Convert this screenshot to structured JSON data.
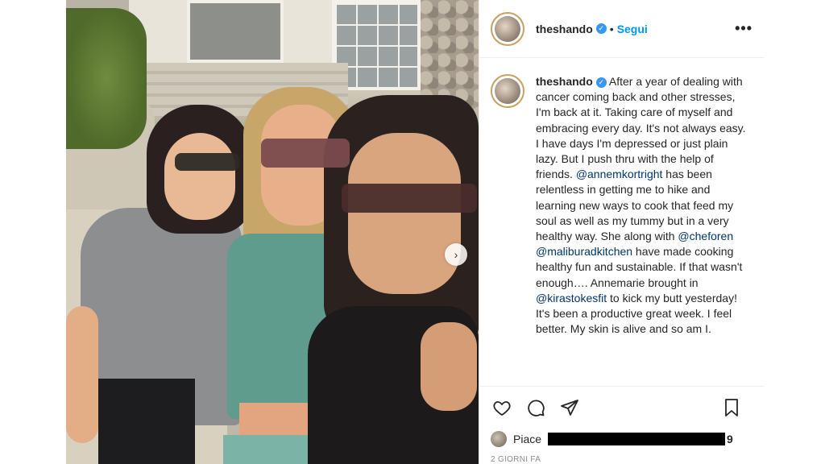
{
  "post": {
    "username": "theshando",
    "verified": true,
    "follow_label": "Segui",
    "separator": "•",
    "more_icon": "•••",
    "next_icon": "›"
  },
  "caption": {
    "username": "theshando",
    "part1": " After a year of dealing with cancer coming back and other stresses, I'm back at it. Taking care of myself and embracing every day. It's not always easy. I have days I'm depressed or just plain lazy. But I push thru with the help of friends. ",
    "mention1": "@annemkortright",
    "part2": " has been relentless in getting me to hike and learning new ways to cook that feed my soul as well as my tummy but in a very healthy way. She along with ",
    "mention2": "@cheforen",
    "part3": " ",
    "mention3": "@maliburadkitchen",
    "part4": " have made cooking healthy fun and sustainable. If that wasn't enough…. Annemarie brought in ",
    "mention4": "@kirastokesfit",
    "part5": " to kick my butt yesterday! It's been a productive great week. I feel better. My skin is alive and so am I."
  },
  "likes": {
    "label": "Piace",
    "suffix": "9"
  },
  "time": "2 GIORNI FA",
  "colors": {
    "link": "#0095f6",
    "mention": "#00376b",
    "verified": "#3897f0"
  }
}
